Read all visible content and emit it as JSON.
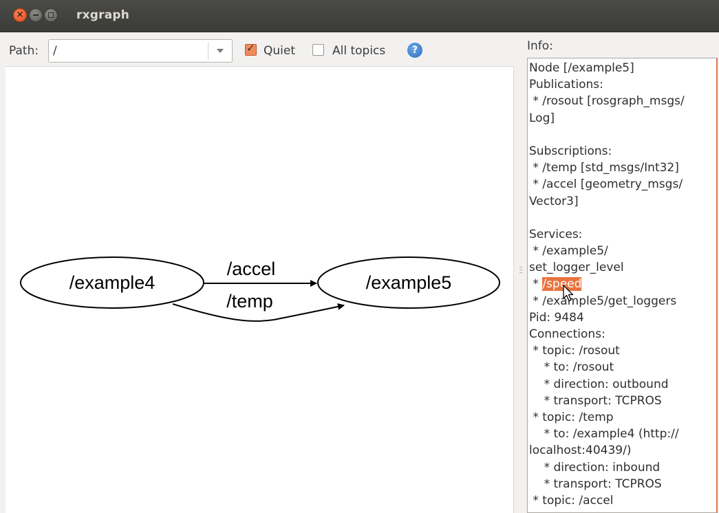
{
  "window": {
    "title": "rxgraph"
  },
  "toolbar": {
    "path_label": "Path:",
    "path_value": "/",
    "quiet_label": "Quiet",
    "quiet_checked": true,
    "all_topics_label": "All topics",
    "all_topics_checked": false,
    "help_icon": "question-circle-icon"
  },
  "graph": {
    "nodes": [
      "/example4",
      "/example5"
    ],
    "edges": [
      "/accel",
      "/temp"
    ]
  },
  "info": {
    "label": "Info:",
    "lines": [
      "Node [/example5]",
      "Publications:",
      " * /rosout [rosgraph_msgs/",
      "Log]",
      "",
      "Subscriptions:",
      " * /temp [std_msgs/Int32]",
      " * /accel [geometry_msgs/",
      "Vector3]",
      "",
      "Services:",
      " * /example5/",
      "set_logger_level",
      " * ",
      " * /example5/get_loggers",
      "Pid: 9484",
      "Connections:",
      " * topic: /rosout",
      "    * to: /rosout",
      "    * direction: outbound",
      "    * transport: TCPROS",
      " * topic: /temp",
      "    * to: /example4 (http://",
      "localhost:40439/)",
      "    * direction: inbound",
      "    * transport: TCPROS",
      " * topic: /accel"
    ],
    "highlighted_text": "/speed"
  },
  "colors": {
    "accent": "#e8743f",
    "titlebar": "#3c3b37",
    "close_button": "#e9541f"
  }
}
